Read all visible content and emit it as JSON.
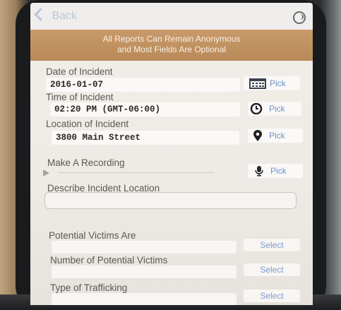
{
  "nav": {
    "back_label": "Back"
  },
  "banner": {
    "line1": "All Reports Can Remain Anonymous",
    "line2": "and Most Fields Are Optional"
  },
  "form": {
    "date": {
      "label": "Date of Incident",
      "value": "2016-01-07",
      "pick_label": "Pick",
      "icon": "calendar-icon"
    },
    "time": {
      "label": "Time of Incident",
      "value": "02:20 PM (GMT-06:00)",
      "pick_label": "Pick",
      "icon": "clock-icon"
    },
    "location": {
      "label": "Location of Incident",
      "value": "3800 Main Street",
      "pick_label": "Pick",
      "icon": "map-pin-icon"
    },
    "recording": {
      "label": "Make A Recording",
      "pick_label": "Pick",
      "icon": "microphone-icon"
    },
    "describe_location": {
      "label": "Describe Incident Location",
      "value": ""
    },
    "victims": {
      "label": "Potential Victims Are",
      "select_label": "Select"
    },
    "num_victims": {
      "label": "Number of Potential Victims",
      "select_label": "Select"
    },
    "trafficking": {
      "label": "Type of Trafficking",
      "select_label": "Select"
    }
  },
  "colors": {
    "banner": "#c39565",
    "accent": "#6c91c7",
    "background": "#efebe6"
  }
}
